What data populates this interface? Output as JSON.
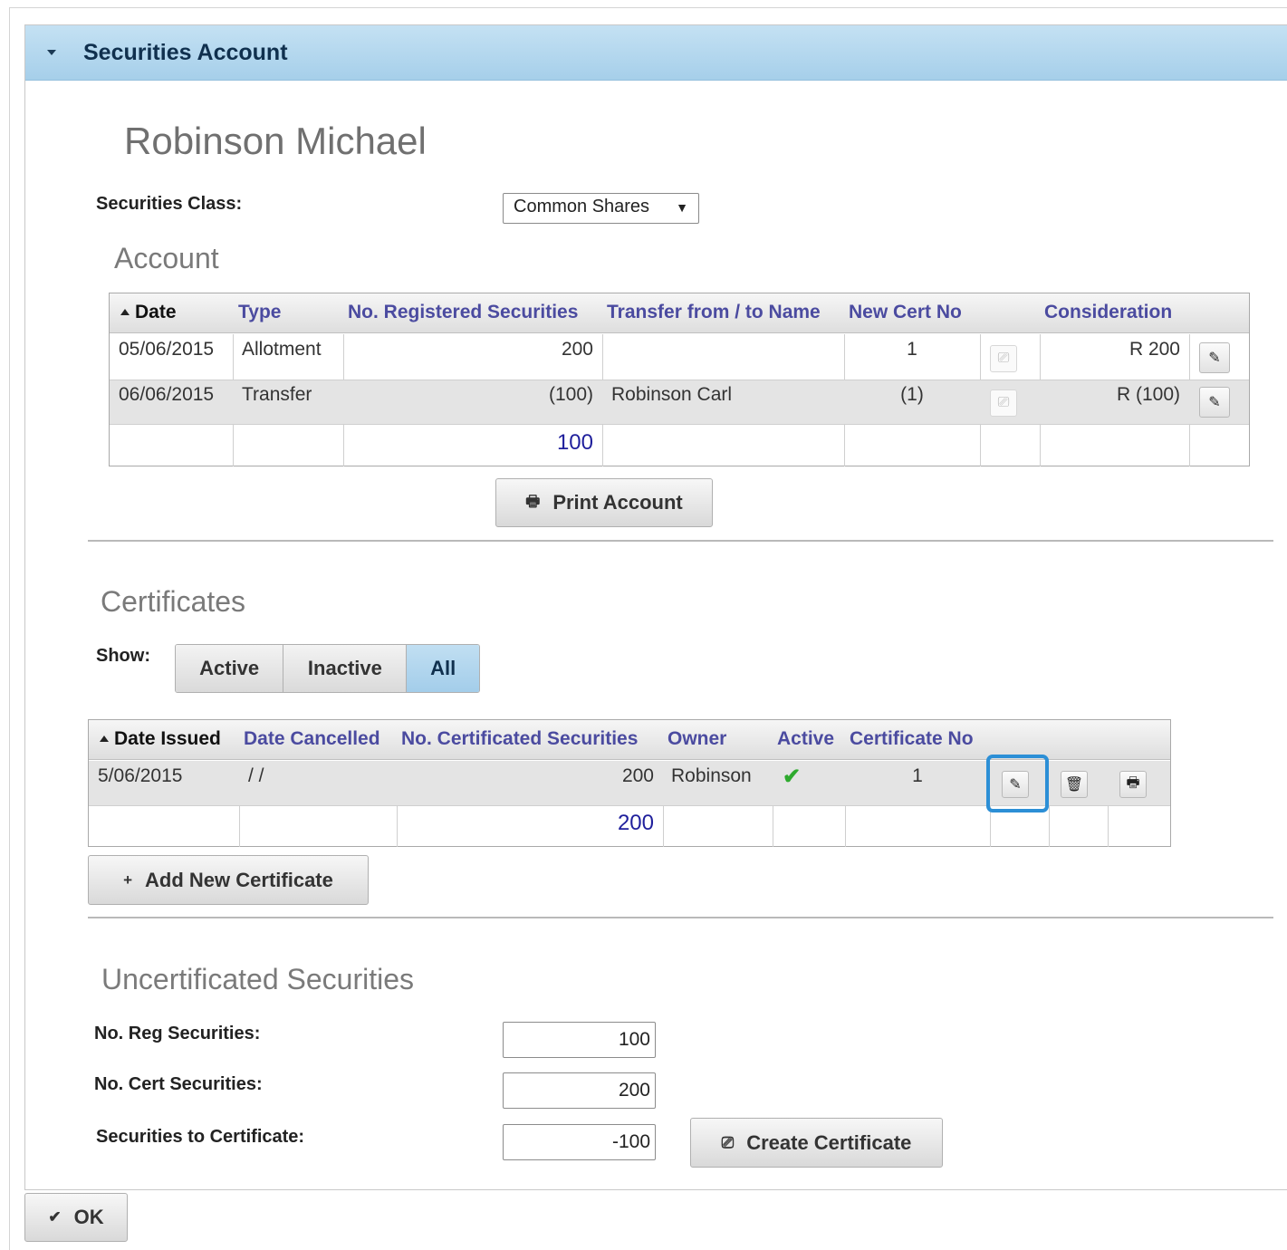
{
  "panel": {
    "title": "Securities Account"
  },
  "person": {
    "name": "Robinson Michael"
  },
  "securities_class": {
    "label": "Securities Class:",
    "selected": "Common Shares"
  },
  "account": {
    "title": "Account",
    "columns": [
      "Date",
      "Type",
      "No. Registered Securities",
      "Transfer from / to Name",
      "New Cert No",
      "Consideration"
    ],
    "rows": [
      {
        "date": "05/06/2015",
        "type": "Allotment",
        "registered": "200",
        "name": "",
        "cert_no": "1",
        "consideration": "R 200"
      },
      {
        "date": "06/06/2015",
        "type": "Transfer",
        "registered": "(100)",
        "name": "Robinson Carl",
        "cert_no": "(1)",
        "consideration": "R (100)"
      }
    ],
    "total": "100",
    "print_label": "Print Account"
  },
  "certificates": {
    "title": "Certificates",
    "show_label": "Show:",
    "filters": [
      "Active",
      "Inactive",
      "All"
    ],
    "active_filter": "All",
    "columns": [
      "Date Issued",
      "Date Cancelled",
      "No. Certificated Securities",
      "Owner",
      "Active",
      "Certificate No"
    ],
    "rows": [
      {
        "date_issued": "5/06/2015",
        "date_cancelled": "/ /",
        "certificated": "200",
        "owner": "Robinson",
        "active": true,
        "cert_no": "1"
      }
    ],
    "total": "200",
    "add_label": "Add New Certificate"
  },
  "uncertificated": {
    "title": "Uncertificated Securities",
    "reg_label": "No. Reg Securities:",
    "reg_value": "100",
    "cert_label": "No. Cert Securities:",
    "cert_value": "200",
    "to_cert_label": "Securities to Certificate:",
    "to_cert_value": "-100",
    "create_label": "Create Certificate"
  },
  "footer": {
    "ok_label": "OK"
  }
}
